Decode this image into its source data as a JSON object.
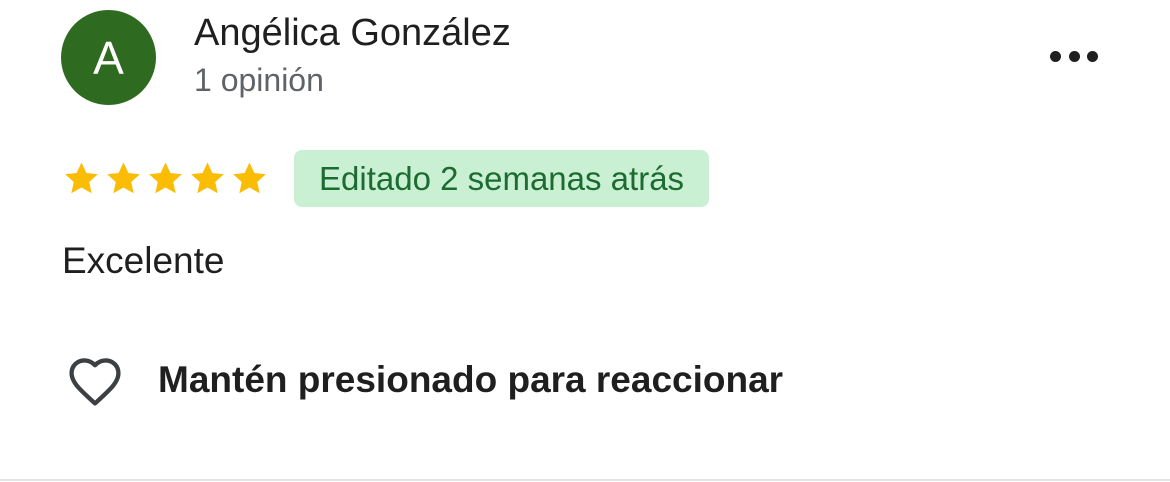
{
  "review": {
    "author": {
      "initial": "A",
      "name": "Angélica González",
      "meta": "1 opinión",
      "avatar_color": "#2e6a1f"
    },
    "menu_icon": "more-horizontal-icon",
    "rating": 5,
    "rating_max": 5,
    "star_color": "#fbbc04",
    "edited_label": "Editado 2 semanas atrás",
    "badge_color": "#c9f0d3",
    "text": "Excelente",
    "reaction": {
      "icon": "heart-outline-icon",
      "label": "Mantén presionado para reaccionar"
    }
  }
}
